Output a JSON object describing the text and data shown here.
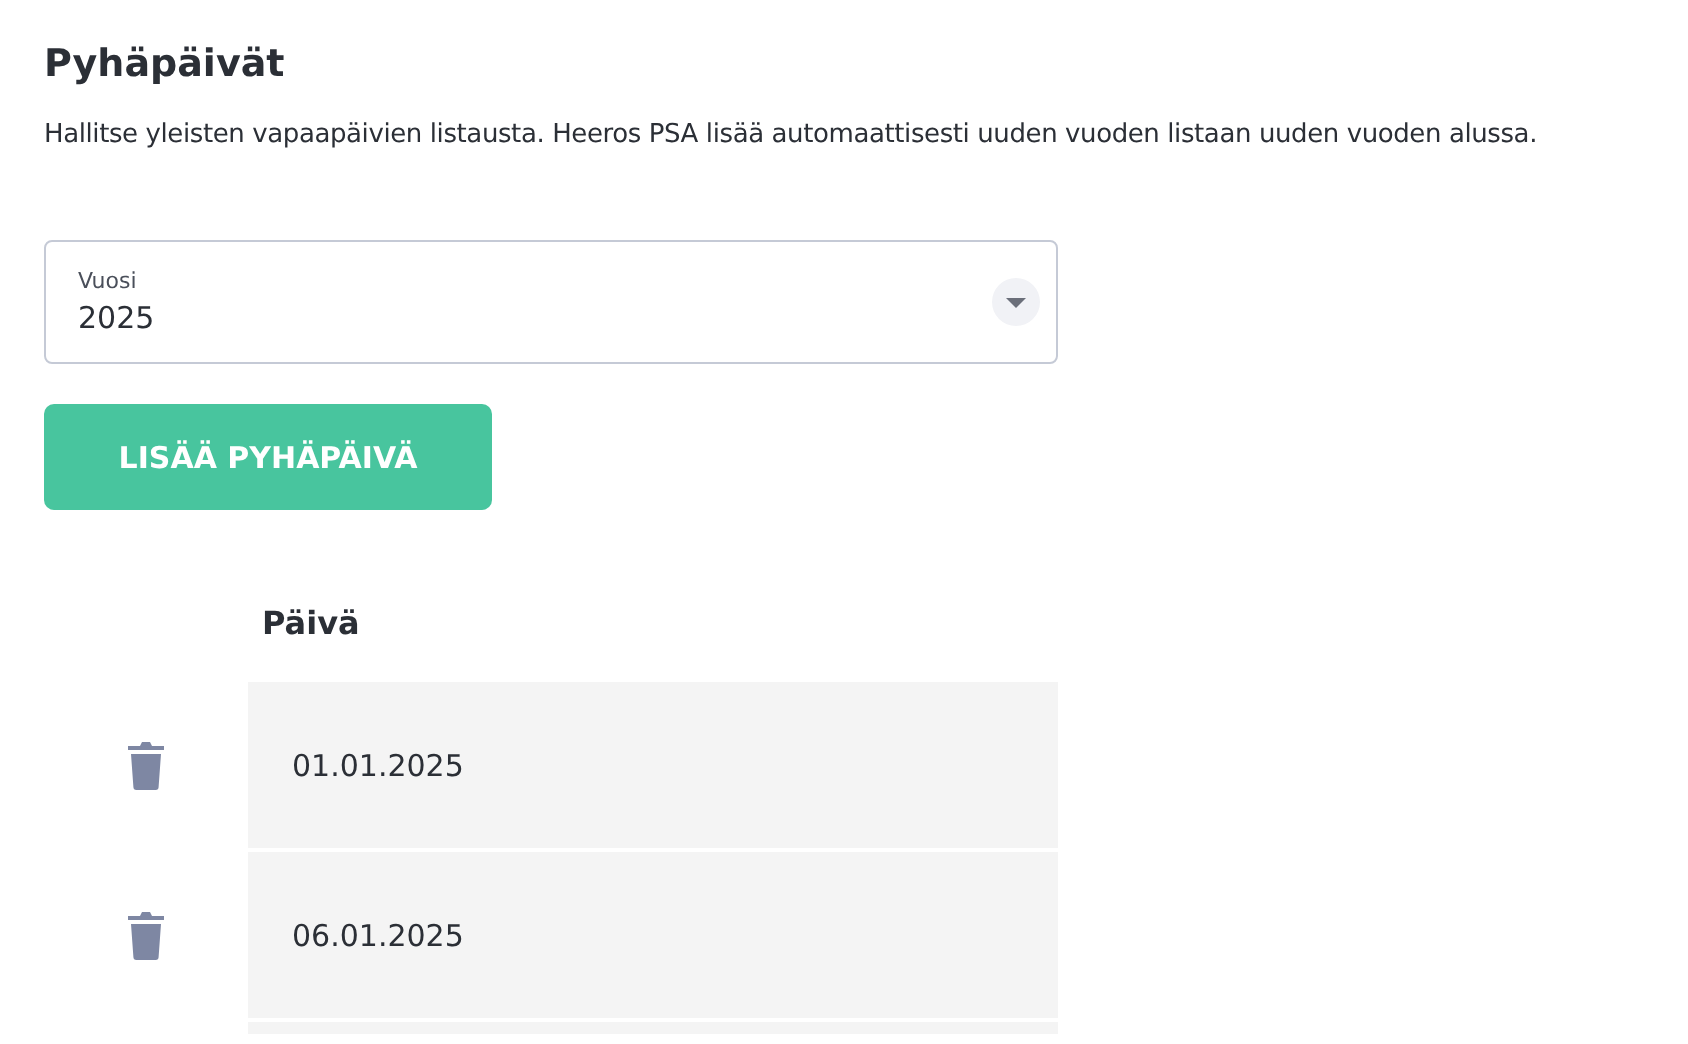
{
  "title": "Pyhäpäivät",
  "description": "Hallitse yleisten vapaapäivien listausta. Heeros PSA lisää automaattisesti uuden vuoden listaan uuden vuoden alussa.",
  "year_select": {
    "label": "Vuosi",
    "value": "2025"
  },
  "add_button": "LISÄÄ PYHÄPÄIVÄ",
  "table": {
    "columns": [
      "Päivä"
    ],
    "rows": [
      {
        "date": "01.01.2025"
      },
      {
        "date": "06.01.2025"
      }
    ]
  }
}
